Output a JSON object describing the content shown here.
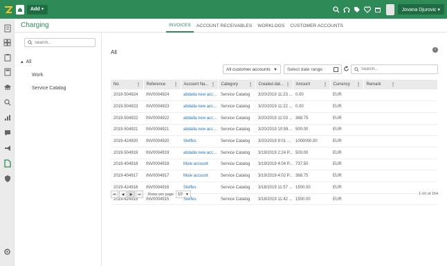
{
  "topbar": {
    "add_label": "Add +",
    "user_label": "Jovana Djurovic ▾",
    "accent": "#2e8b57"
  },
  "app": {
    "title": "Charging"
  },
  "tabs": [
    {
      "label": "INVOICES",
      "active": true
    },
    {
      "label": "ACCOUNT RECEIVABLES",
      "active": false
    },
    {
      "label": "WORKLOGS",
      "active": false
    },
    {
      "label": "CUSTOMER ACCOUNTS",
      "active": false
    }
  ],
  "sidebar": {
    "search_placeholder": "Search...",
    "root_label": "All",
    "items": [
      {
        "label": "Work"
      },
      {
        "label": "Service Catalog"
      }
    ]
  },
  "main": {
    "title": "All",
    "filter_value": "All customer accounts",
    "date_placeholder": "Select date range",
    "search_placeholder": "Search..."
  },
  "table": {
    "columns": [
      "No",
      "Reference",
      "Account Na...",
      "Category",
      "Created dat...",
      "Amount",
      "Currency",
      "Remark"
    ],
    "rows": [
      [
        "2019-504924",
        "INV0004924",
        "abdalla new acco...",
        "Service Catalog",
        "3/20/2019 11:23 ...",
        "0.00",
        "EUR",
        ""
      ],
      [
        "2019-504923",
        "INV0004923",
        "abdalla new acco...",
        "Service Catalog",
        "3/20/2019 11:22 ...",
        "0.00",
        "EUR",
        ""
      ],
      [
        "2019-504922",
        "INV0004922",
        "abdalla new acco...",
        "Service Catalog",
        "3/20/2019 11:03 ...",
        "368.75",
        "EUR",
        ""
      ],
      [
        "2019-504921",
        "INV0004921",
        "abdalla new acco...",
        "Service Catalog",
        "3/20/2019 10:59 ...",
        "500.00",
        "EUR",
        ""
      ],
      [
        "2019-424920",
        "INV0004920",
        "Steffes",
        "Service Catalog",
        "3/20/2019 9:01 A...",
        "1000000.00",
        "EUR",
        ""
      ],
      [
        "2019-504919",
        "INV0004919",
        "abdalla new acco...",
        "Service Catalog",
        "3/19/2019 2:24 P...",
        "500.00",
        "EUR",
        ""
      ],
      [
        "2019-404918",
        "INV0004918",
        "Mule account",
        "Service Catalog",
        "3/19/2019 4:04 P...",
        "737.50",
        "EUR",
        ""
      ],
      [
        "2019-404917",
        "INV0004917",
        "Mule account",
        "Service Catalog",
        "3/19/2019 4:02 P...",
        "368.75",
        "EUR",
        ""
      ],
      [
        "2019-424916",
        "INV0004916",
        "Steffes",
        "Service Catalog",
        "3/18/2019 11:57 ...",
        "1500.00",
        "EUR",
        ""
      ],
      [
        "2019-424915",
        "INV0004915",
        "Steffes",
        "Service Catalog",
        "3/18/2019 11:42 ...",
        "1500.00",
        "EUR",
        ""
      ]
    ]
  },
  "pagination": {
    "rows_per_page_label": "Rows per page",
    "rows_per_page_value": "10",
    "range_text": "1-10 of 154"
  }
}
